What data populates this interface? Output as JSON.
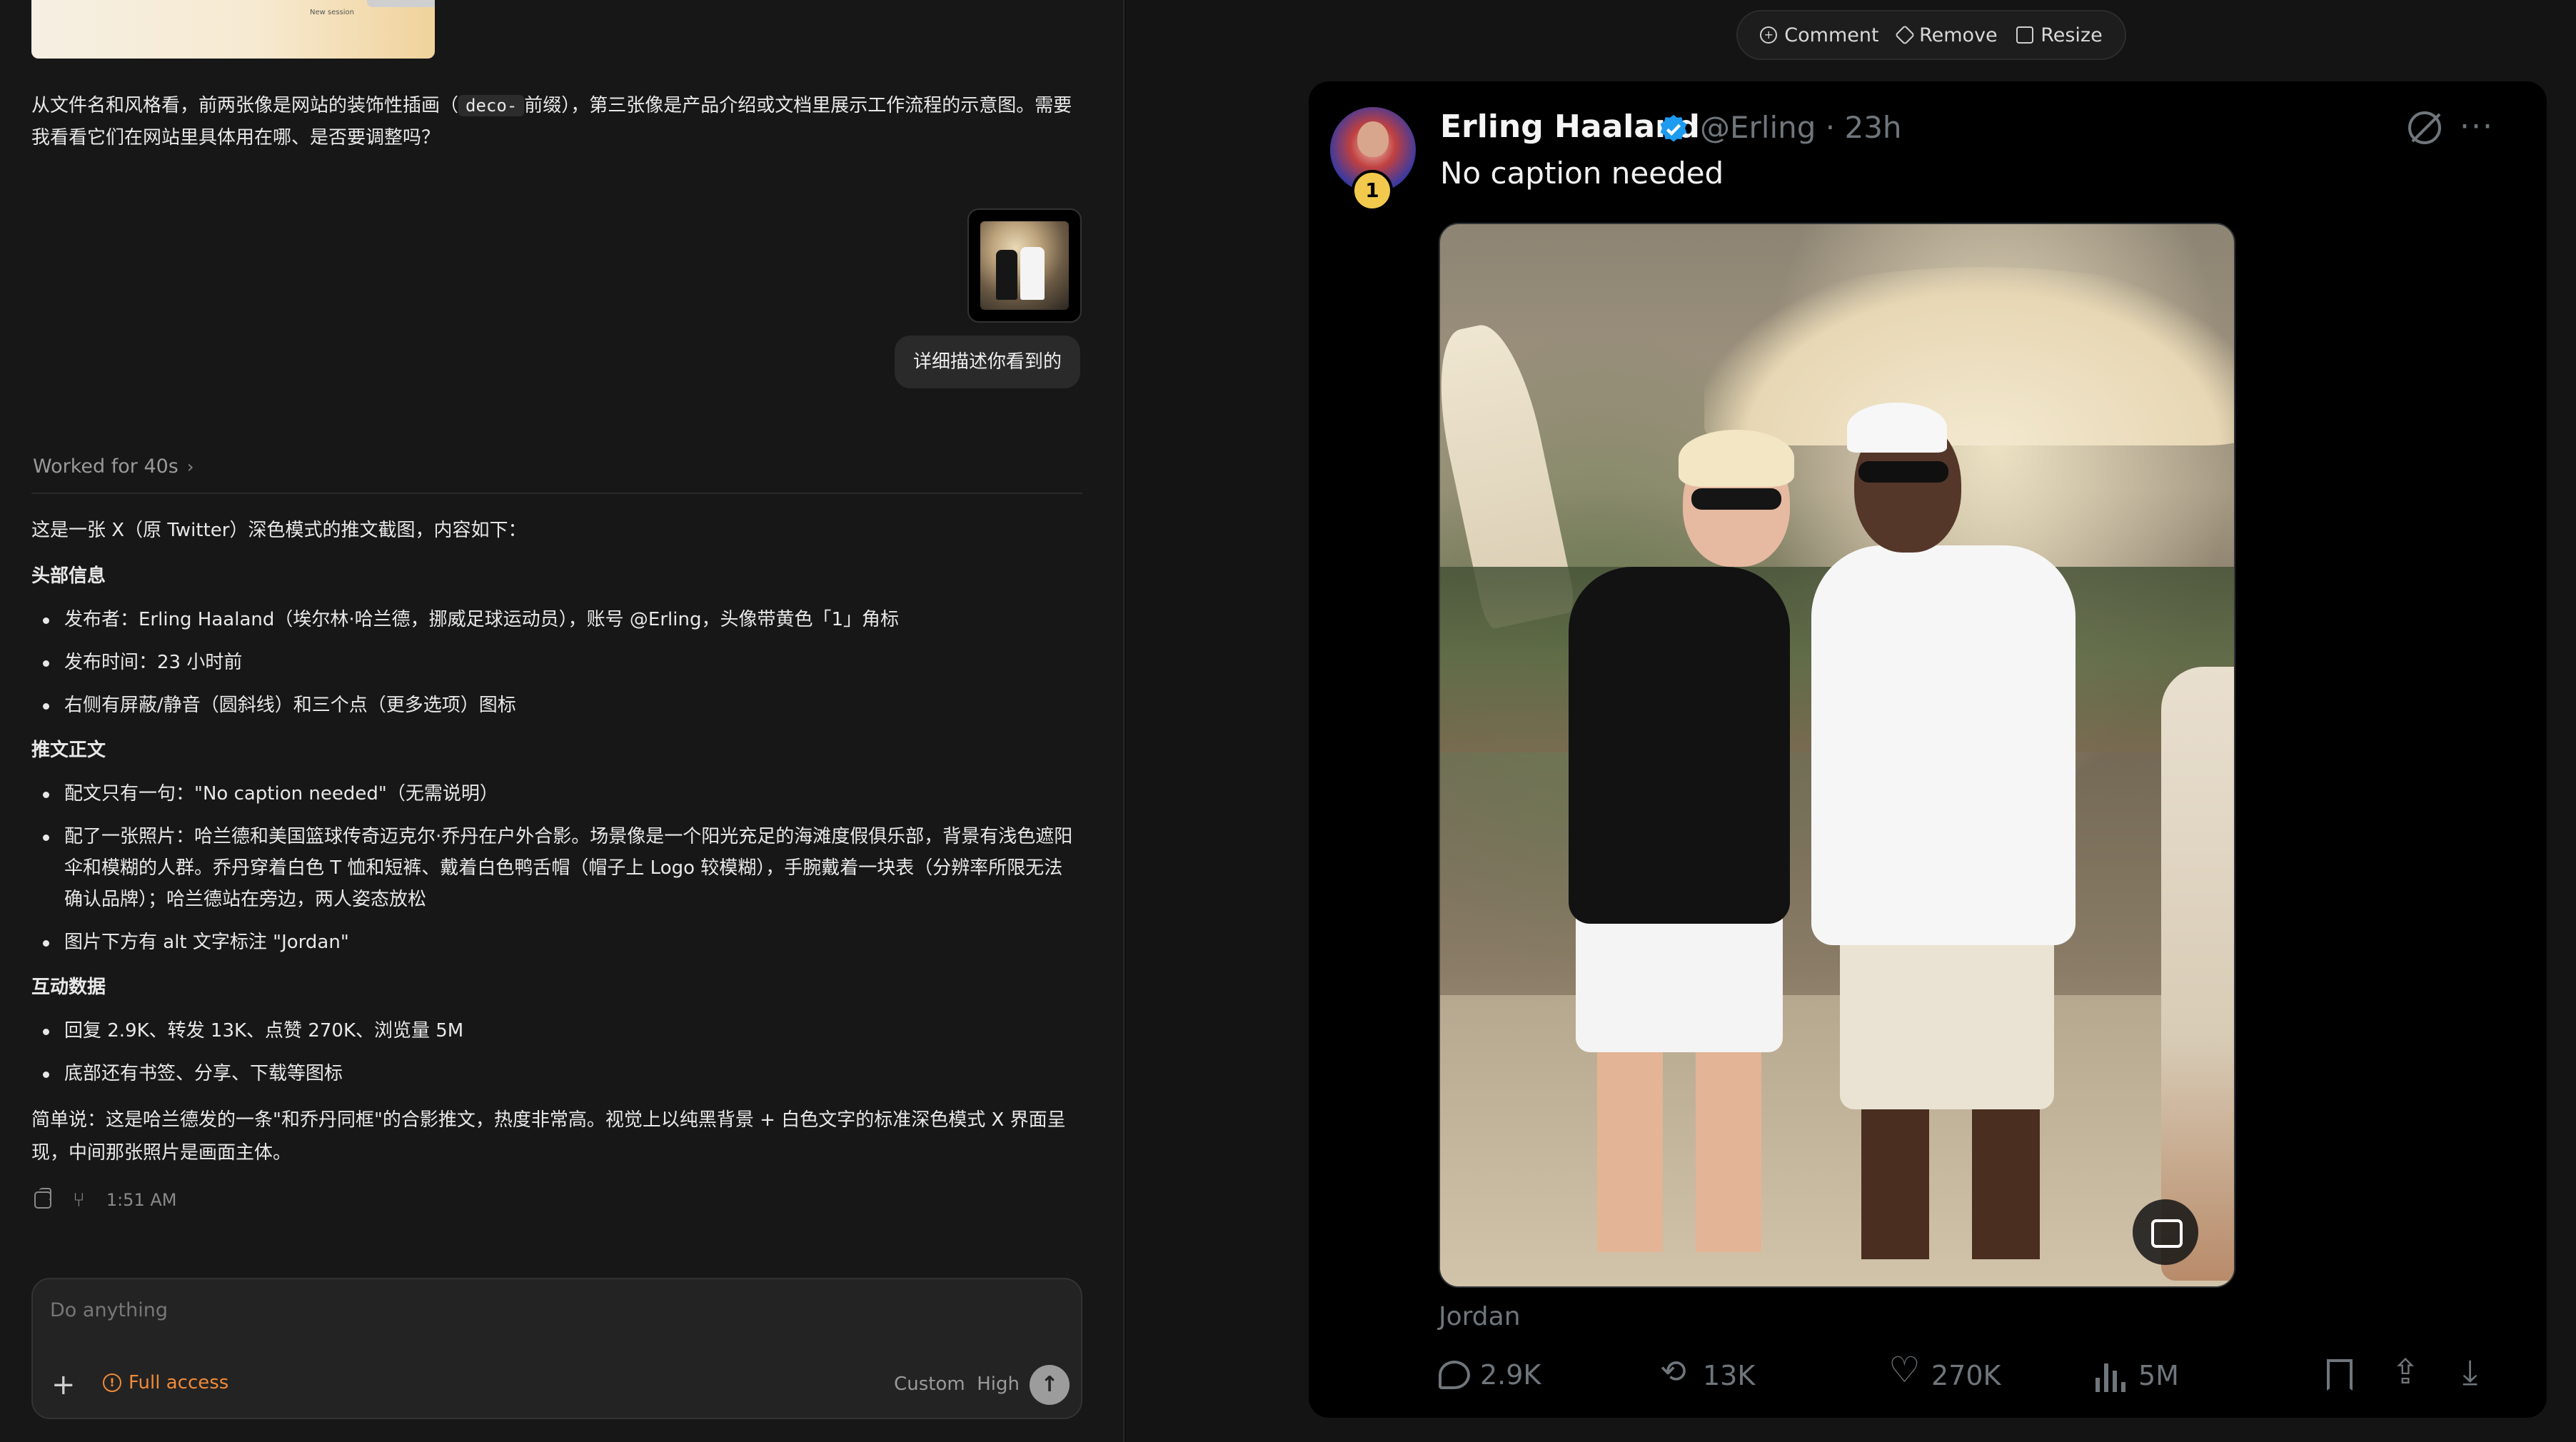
{
  "left_pane": {
    "assistant_intro": "从文件名和风格看，前两张像是网站的装饰性插画（",
    "assistant_intro_code": "deco-",
    "assistant_intro_tail": "前缀），第三张像是产品介绍或文档里展示工作流程的示意图。需要我看看它们在网站里具体用在哪、是否要调整吗？",
    "preview_caption": "New session",
    "user_message": "详细描述你看到的",
    "worked_label": "Worked for 40s",
    "answer": {
      "intro": "这是一张 X（原 Twitter）深色模式的推文截图，内容如下：",
      "sections": [
        {
          "heading": "头部信息",
          "items": [
            "发布者：Erling Haaland（埃尔林·哈兰德，挪威足球运动员），账号 @Erling，头像带黄色「1」角标",
            "发布时间：23 小时前",
            "右侧有屏蔽/静音（圆斜线）和三个点（更多选项）图标"
          ]
        },
        {
          "heading": "推文正文",
          "items": [
            "配文只有一句：\"No caption needed\"（无需说明）",
            "配了一张照片：哈兰德和美国篮球传奇迈克尔·乔丹在户外合影。场景像是一个阳光充足的海滩度假俱乐部，背景有浅色遮阳伞和模糊的人群。乔丹穿着白色 T 恤和短裤、戴着白色鸭舌帽（帽子上 Logo 较模糊），手腕戴着一块表（分辨率所限无法确认品牌）；哈兰德站在旁边，两人姿态放松",
            "图片下方有 alt 文字标注 \"Jordan\""
          ]
        },
        {
          "heading": "互动数据",
          "items": [
            "回复 2.9K、转发 13K、点赞 270K、浏览量 5M",
            "底部还有书签、分享、下载等图标"
          ]
        }
      ],
      "summary": "简单说：这是哈兰德发的一条\"和乔丹同框\"的合影推文，热度非常高。视觉上以纯黑背景 + 白色文字的标准深色模式 X 界面呈现，中间那张照片是画面主体。"
    },
    "timestamp": "1:51 AM",
    "composer": {
      "placeholder": "Do anything",
      "access_label": "Full access",
      "model_label": "Custom",
      "effort_label": "High"
    }
  },
  "right_pane": {
    "toolbar": {
      "comment": "Comment",
      "remove": "Remove",
      "resize": "Resize"
    },
    "tweet": {
      "name": "Erling Haaland",
      "handle_time": "@Erling · 23h",
      "badge": "1",
      "text": "No caption needed",
      "alt_label": "Jordan",
      "replies": "2.9K",
      "retweets": "13K",
      "likes": "270K",
      "views": "5M"
    }
  }
}
